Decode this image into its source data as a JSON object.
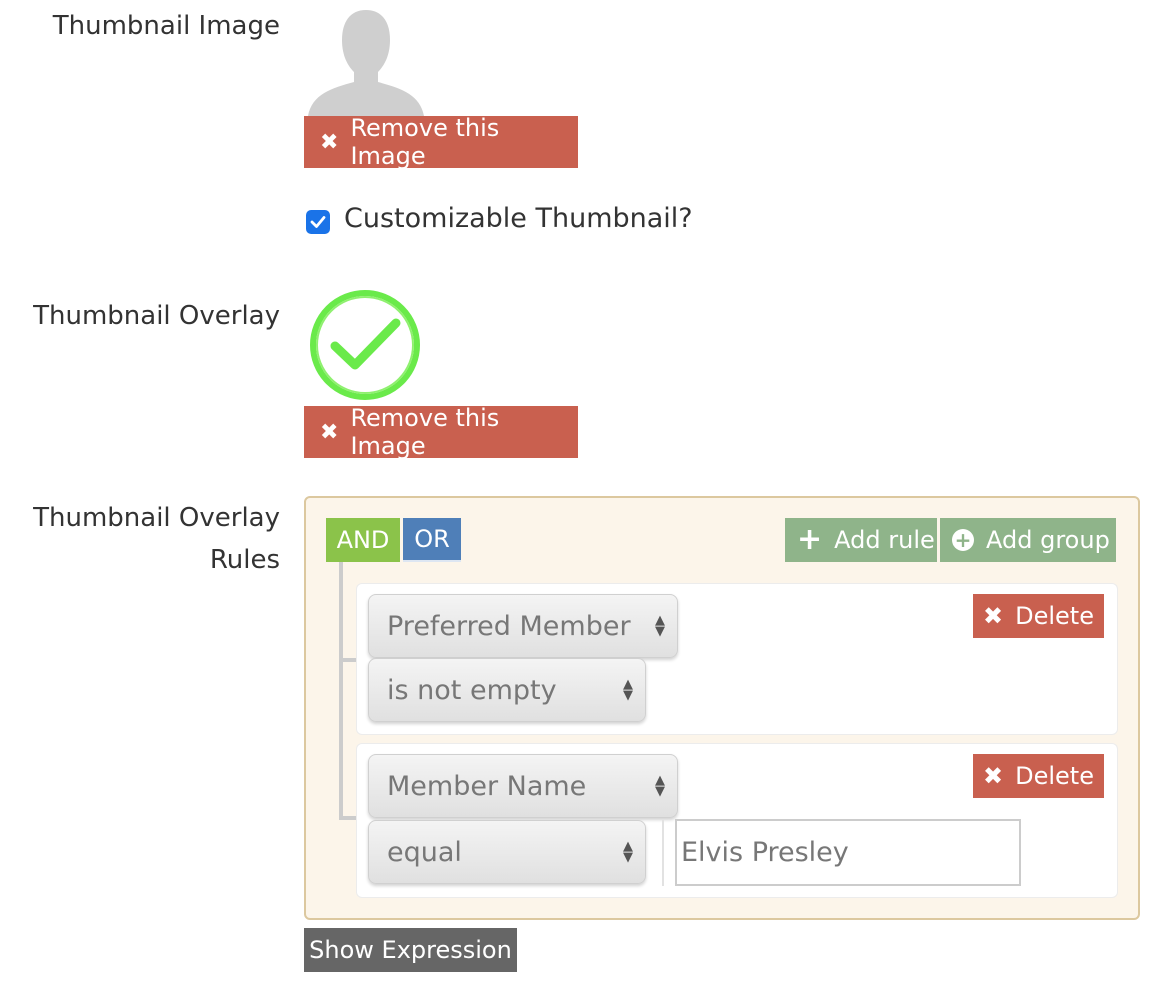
{
  "thumbnail_image": {
    "label": "Thumbnail Image",
    "remove_label": "Remove this Image",
    "image_icon": "person-silhouette-icon"
  },
  "customizable": {
    "checked": true,
    "label": "Customizable Thumbnail?"
  },
  "thumbnail_overlay": {
    "label": "Thumbnail Overlay",
    "remove_label": "Remove this Image",
    "image_icon": "green-checkmark-circle-icon"
  },
  "overlay_rules": {
    "label_line1": "Thumbnail Overlay",
    "label_line2": "Rules",
    "condition_and": "AND",
    "condition_or": "OR",
    "active_condition": "AND",
    "add_rule_label": "Add rule",
    "add_group_label": "Add group",
    "rules": [
      {
        "field": "Preferred Member",
        "operator": "is not empty",
        "value": "",
        "delete_label": "Delete"
      },
      {
        "field": "Member Name",
        "operator": "equal",
        "value": "Elvis Presley",
        "delete_label": "Delete"
      }
    ]
  },
  "show_expression_label": "Show Expression",
  "colors": {
    "danger": "#c9604f",
    "and_active": "#8bc34a",
    "or_inactive": "#4f7fb8",
    "add_buttons": "#8fb48a",
    "checkbox": "#1a73e8",
    "builder_bg": "#fcf5ea",
    "builder_border": "#dcc89f",
    "overlay_green": "#6aea4a"
  }
}
